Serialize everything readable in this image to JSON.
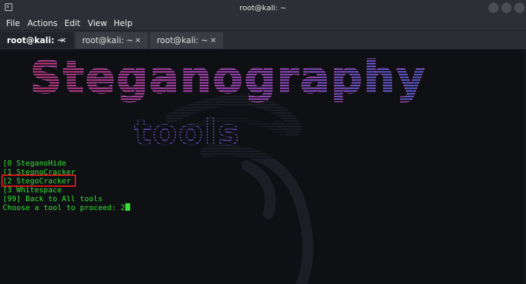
{
  "window": {
    "title": "root@kali: ~"
  },
  "menu": [
    "File",
    "Actions",
    "Edit",
    "View",
    "Help"
  ],
  "tabs": [
    {
      "label": "root@kali: ~",
      "active": true,
      "close": "×"
    },
    {
      "label": "root@kali: ~",
      "active": false,
      "close": "×"
    },
    {
      "label": "root@kali: ~",
      "active": false,
      "close": "×"
    }
  ],
  "banner": {
    "line1": "Steganography",
    "line2": "tools"
  },
  "terminal": {
    "lines": [
      "[0 SteganoHide",
      "[1 StegnoCracker",
      "[2 StegoCracker",
      "[3 Whitespace",
      "[99] Back to All tools"
    ],
    "prompt": "Choose a tool to proceed: 2"
  },
  "colors": {
    "output_text": "#34e034",
    "highlight": "#e01818"
  }
}
